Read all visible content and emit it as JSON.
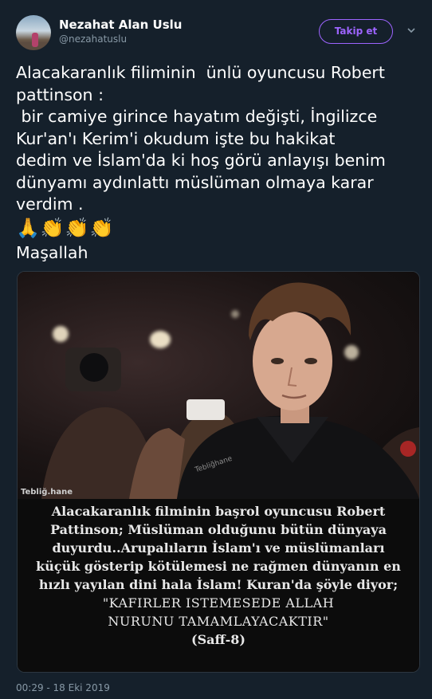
{
  "user": {
    "display_name": "Nezahat Alan Uslu",
    "handle": "@nezahatuslu"
  },
  "follow_label": "Takip et",
  "tweet": {
    "text": "Alacakaranlık filiminin  ünlü oyuncusu Robert\npattinson :\n bir camiye girince hayatım değişti, İngilizce\nKur'an'ı Kerim'i okudum işte bu hakikat\ndedim ve İslam'da ki hoş görü anlayışı benim\ndünyamı aydınlattı müslüman olmaya karar\nverdim .",
    "emojis": [
      "🙏",
      "👏",
      "👏",
      "👏"
    ],
    "closing": "Maşallah"
  },
  "media": {
    "watermark_left": "Tebliğ.hane",
    "watermark_center": "Tebliğhane",
    "caption_lines": [
      "Alacakaranlık filminin başrol oyuncusu Robert",
      "Pattinson; Müslüman olduğunu bütün dünyaya",
      "duyurdu..Arupalıların İslam'ı ve müslümanları",
      "küçük gösterip kötülemesi ne rağmen dünyanın en",
      "hızlı yayılan dini hala İslam! Kuran'da şöyle diyor;",
      "\"KAFIRLER ISTEMESEDE ALLAH",
      "NURUNU TAMAMLAYACAKTIR\"",
      "(Saff-8)"
    ]
  },
  "timestamp": "00:29 - 18 Eki 2019",
  "colors": {
    "background": "#15202b",
    "accent": "#9d64ff",
    "muted": "#8899a6"
  }
}
